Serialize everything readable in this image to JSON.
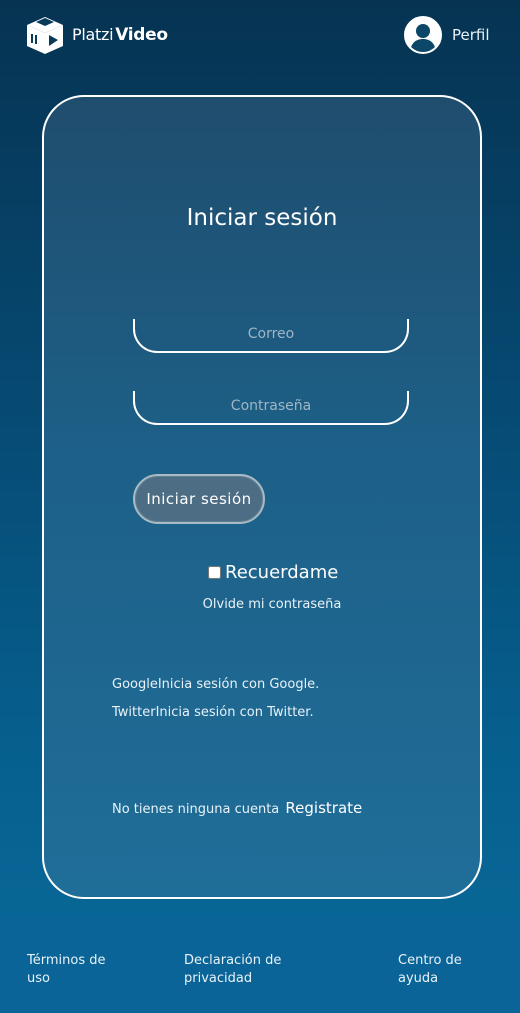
{
  "header": {
    "logo_text_platzi": "Platzi",
    "logo_text_video": "Video",
    "profile_label": "Perfil"
  },
  "login": {
    "title": "Iniciar sesión",
    "email_placeholder": "Correo",
    "password_placeholder": "Contraseña",
    "submit_label": "Iniciar sesión",
    "remember_label": "Recuerdame",
    "forgot_label": "Olvide mi contraseña",
    "google_label": "GoogleInicia sesión con Google.",
    "twitter_label": "TwitterInicia sesión con Twitter.",
    "no_account_text": "No tienes ninguna cuenta",
    "register_label": "Registrate"
  },
  "footer": {
    "links": [
      "Términos de uso",
      "Declaración de privacidad",
      "Centro de ayuda"
    ]
  },
  "icons": {
    "logo": "cube-play-icon",
    "avatar": "user-avatar-icon"
  }
}
